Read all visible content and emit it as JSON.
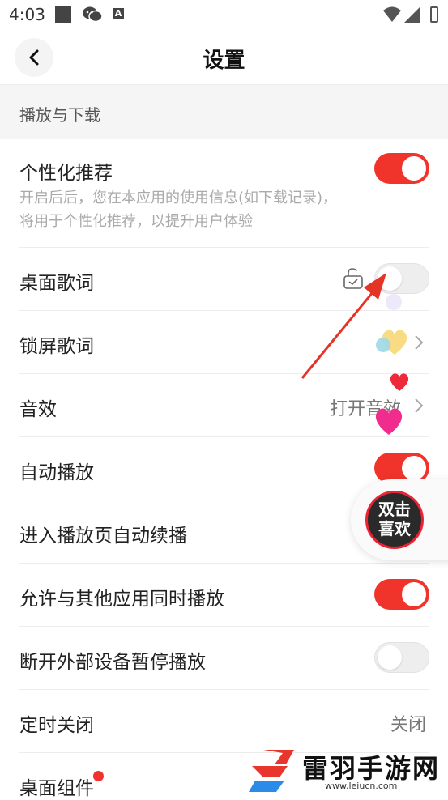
{
  "status_bar": {
    "time": "4:03",
    "icons": [
      "gallery-icon",
      "wechat-icon",
      "a-icon",
      "wifi-icon",
      "signal-icon",
      "battery-icon"
    ],
    "a_glyph": "A"
  },
  "header": {
    "title": "设置",
    "back_icon": "chevron-left-icon"
  },
  "section": {
    "title": "播放与下载"
  },
  "settings": {
    "personalized": {
      "label": "个性化推荐",
      "desc_line1": "开启后后，您在本应用的使用信息(如下载记录)，",
      "desc_line2": "将用于个性化推荐，以提升用户体验",
      "enabled": true
    },
    "desktop_lyrics": {
      "label": "桌面歌词",
      "enabled": false,
      "icon": "unlock-icon"
    },
    "lockscreen_lyrics": {
      "label": "锁屏歌词"
    },
    "sound_effect": {
      "label": "音效",
      "value": "打开音效"
    },
    "auto_play": {
      "label": "自动播放",
      "enabled": true
    },
    "auto_continue": {
      "label": "进入播放页自动续播"
    },
    "mix_play": {
      "label": "允许与其他应用同时播放",
      "enabled": true
    },
    "pause_on_disconnect": {
      "label": "断开外部设备暂停播放",
      "enabled": false
    },
    "timer_close": {
      "label": "定时关闭",
      "value": "关闭"
    },
    "desktop_widget": {
      "label": "桌面组件",
      "badge": true
    }
  },
  "floating_button": {
    "line1": "双击",
    "line2": "喜欢"
  },
  "watermark": {
    "brand": "雷羽手游网",
    "url": "www.leiucn.com"
  },
  "colors": {
    "accent": "#f0342c",
    "toggle_off": "#eeeeee",
    "section_bg": "#f5f5f5"
  }
}
